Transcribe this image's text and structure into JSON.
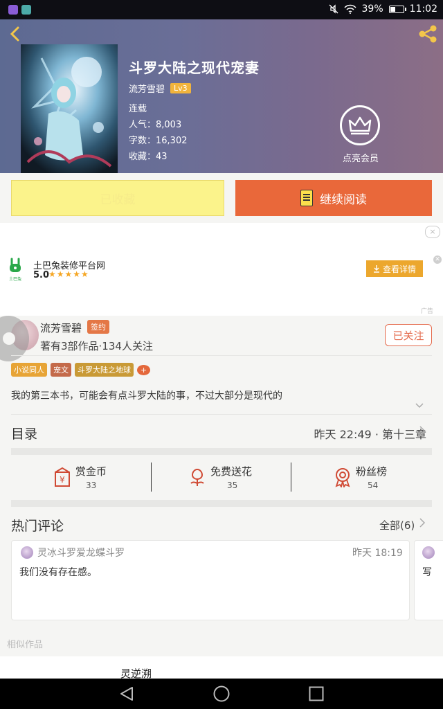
{
  "status_bar": {
    "battery": "39%",
    "time": "11:02"
  },
  "book": {
    "title": "斗罗大陆之现代宠妻",
    "author": "流芳雪碧",
    "level": "Lv3",
    "status": "连载",
    "popularity": "人气：8,003",
    "word_count": "字数：16,302",
    "favorites": "收藏：43"
  },
  "vip": {
    "label": "点亮会员"
  },
  "actions": {
    "favorited_label": "已收藏",
    "continue_label": "继续阅读"
  },
  "ad": {
    "close": "×",
    "name": "土巴兔装修平台网",
    "logo_text": "土巴兔",
    "rating": "5.0",
    "stars": "★★★★★",
    "button": "查看详情",
    "tag": "广告"
  },
  "author_card": {
    "name": "流芳雪碧",
    "badge": "签约",
    "works": "著有3部作品·134人关注",
    "follow": "已关注",
    "tags": [
      {
        "label": "小说同人",
        "color": "#e7a436"
      },
      {
        "label": "宠文",
        "color": "#c46a4a"
      },
      {
        "label": "斗罗大陆之地球",
        "color": "#c99a36"
      },
      {
        "label": "+",
        "color": "#e4683b"
      }
    ],
    "description": "我的第三本书，可能会有点斗罗大陆的事，不过大部分是现代的"
  },
  "catalog": {
    "title": "目录",
    "latest": "昨天 22:49 · 第十三章"
  },
  "stats": [
    {
      "label": "赏金币",
      "value": "33",
      "icon": "coin-icon"
    },
    {
      "label": "免费送花",
      "value": "35",
      "icon": "flower-icon"
    },
    {
      "label": "粉丝榜",
      "value": "54",
      "icon": "medal-icon"
    }
  ],
  "comments": {
    "title": "热门评论",
    "all": "全部(6)",
    "items": [
      {
        "user": "灵冰斗罗爱龙蝶斗罗",
        "time": "昨天 18:19",
        "text": "我们没有存在感。"
      },
      {
        "user": "",
        "time": "",
        "text": "写"
      }
    ]
  },
  "similar": {
    "title": "相似作品",
    "first_book": "灵逆溯"
  },
  "colors": {
    "accent": "#e9683a",
    "header": "#6a6e97",
    "fav_button": "#fbf38b"
  }
}
